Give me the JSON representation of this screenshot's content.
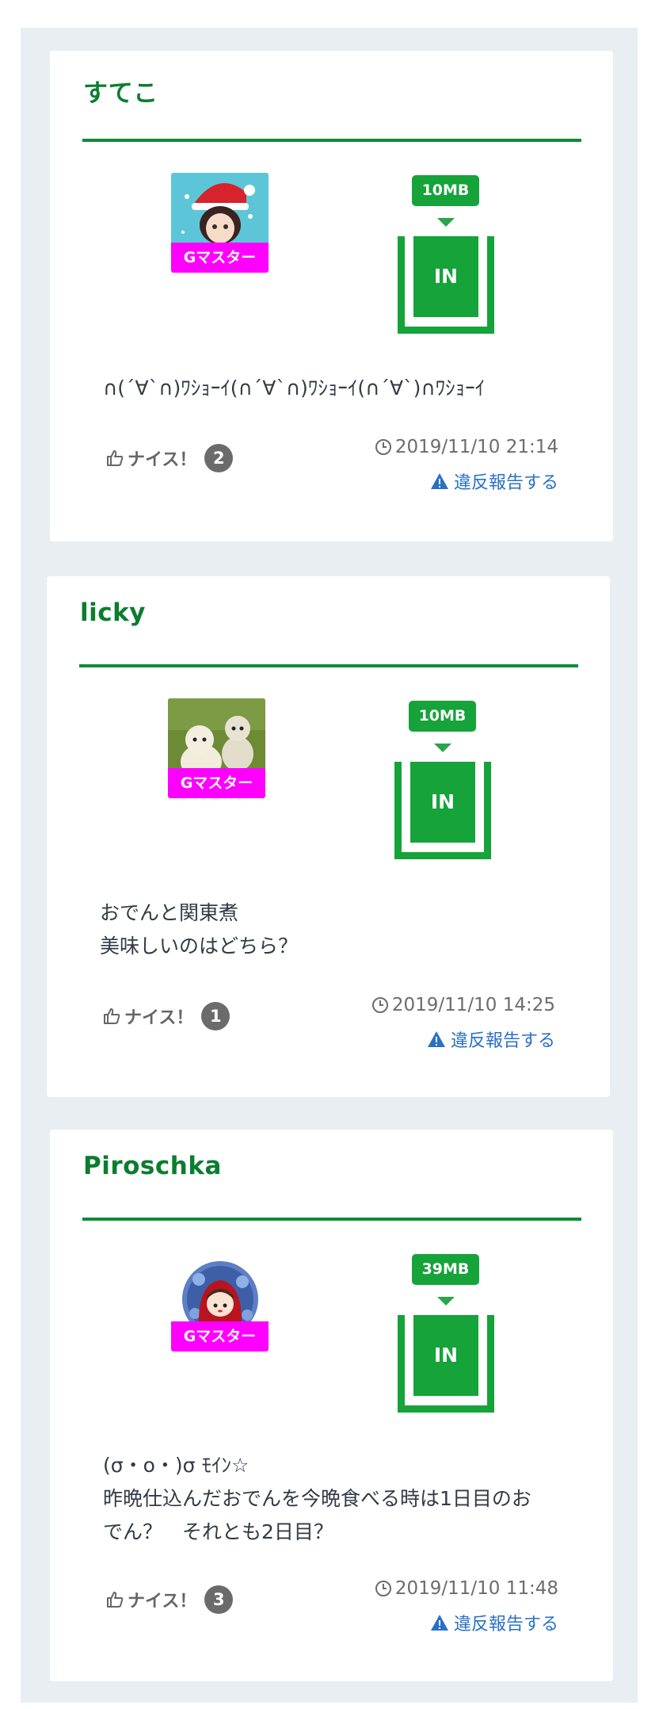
{
  "posts": [
    {
      "name": "すてこ",
      "badge": "Gマスター",
      "size": "10MB",
      "in_label": "IN",
      "message": "∩(´∀`∩)ﾜｼｮｰｲ(∩´∀`∩)ﾜｼｮｰｲ(∩´∀`)∩ﾜｼｮｰｲ",
      "nice_label": "ナイス！",
      "nice_count": "2",
      "timestamp": "2019/11/10 21:14",
      "report": "違反報告する",
      "avatar_icon": "santa-girl-avatar"
    },
    {
      "name": "licky",
      "badge": "Gマスター",
      "size": "10MB",
      "in_label": "IN",
      "message": "おでんと関東煮\n美味しいのはどちら？",
      "nice_label": "ナイス！",
      "nice_count": "1",
      "timestamp": "2019/11/10 14:25",
      "report": "違反報告する",
      "avatar_icon": "dogs-avatar"
    },
    {
      "name": "Piroschka",
      "badge": "Gマスター",
      "size": "39MB",
      "in_label": "IN",
      "message": "(σ・o・)σ ﾓｲﾝ☆\n昨晩仕込んだおでんを今晩食べる時は1日目のお\nでん？　それとも2日目？",
      "nice_label": "ナイス！",
      "nice_count": "3",
      "timestamp": "2019/11/10 11:48",
      "report": "違反報告する",
      "avatar_icon": "red-hood-avatar"
    }
  ],
  "colors": {
    "name_green": "#0b7d2f",
    "accent_green": "#15a33a",
    "badge_magenta": "#ff00ff",
    "link_blue": "#2a71c5"
  }
}
